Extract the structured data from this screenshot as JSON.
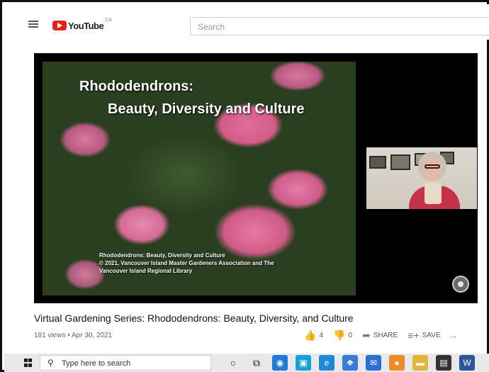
{
  "header": {
    "logo_text": "YouTube",
    "logo_region": "CA",
    "search_placeholder": "Search"
  },
  "player": {
    "slide_title": "Rhododendrons:",
    "slide_subtitle": "Beauty, Diversity and Culture",
    "slide_credit_lines": [
      "Rhododendrons: Beauty, Diversity and Culture",
      "© 2021, Vancouver Island Master Gardeners Association and The",
      "Vancouver Island Regional Library"
    ]
  },
  "video": {
    "title": "Virtual Gardening Series: Rhododendrons: Beauty, Diversity, and Culture",
    "meta": "181 views • Apr 30, 2021",
    "likes": "4",
    "dislikes": "0",
    "share_label": "SHARE",
    "save_label": "SAVE",
    "more_label": "..."
  },
  "taskbar": {
    "search_placeholder": "Type here to search",
    "icons": [
      {
        "name": "cortana-icon",
        "color": "transparent",
        "glyph": "○"
      },
      {
        "name": "task-view-icon",
        "color": "transparent",
        "glyph": "⧉"
      },
      {
        "name": "app-blue-circle-icon",
        "color": "#1f7bd6",
        "glyph": "◉"
      },
      {
        "name": "app-teal-icon",
        "color": "#1aa0d8",
        "glyph": "▣"
      },
      {
        "name": "edge-icon",
        "color": "#1e8ad6",
        "glyph": "e"
      },
      {
        "name": "dropbox-icon",
        "color": "#3a7bd5",
        "glyph": "❖"
      },
      {
        "name": "mail-icon",
        "color": "#2b6fd2",
        "glyph": "✉"
      },
      {
        "name": "firefox-icon",
        "color": "#f08a24",
        "glyph": "●"
      },
      {
        "name": "file-explorer-icon",
        "color": "#e3b43c",
        "glyph": "▬"
      },
      {
        "name": "store-icon",
        "color": "#333333",
        "glyph": "▤"
      },
      {
        "name": "word-icon",
        "color": "#2b579a",
        "glyph": "W"
      }
    ]
  },
  "colors": {
    "youtube_red": "#e62117",
    "taskbar_bg": "#e9e9ec"
  }
}
